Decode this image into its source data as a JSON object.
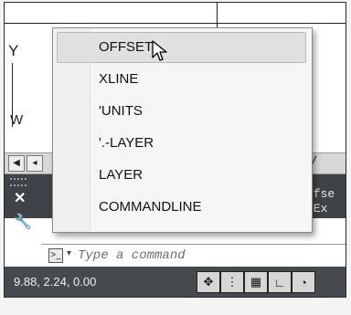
{
  "drawing": {
    "ucs_y_label": "Y",
    "ucs_w_label": "W"
  },
  "layout_tabs": {
    "nav_first_icon": "first-tab-icon",
    "nav_prev_icon": "prev-tab-icon"
  },
  "command_history": {
    "lines": [
      "ffse",
      "[Ex"
    ]
  },
  "command_line": {
    "placeholder": "Type a command",
    "prompt_icon": "command-prompt-icon"
  },
  "autocomplete_menu": {
    "items": [
      {
        "label": "OFFSET",
        "selected": true
      },
      {
        "label": "XLINE",
        "selected": false
      },
      {
        "label": "'UNITS",
        "selected": false
      },
      {
        "label": "'.-LAYER",
        "selected": false
      },
      {
        "label": "LAYER",
        "selected": false
      },
      {
        "label": "COMMANDLINE",
        "selected": false
      }
    ]
  },
  "status_bar": {
    "coordinates": "9.88, 2.24, 0.00",
    "buttons": [
      "snap-mode-icon",
      "grid-display-icon",
      "grid-icon",
      "ortho-icon",
      "polar-icon"
    ]
  },
  "colors": {
    "panel_dark": "#3f4347",
    "status_dark": "#46494d",
    "menu_bg": "#f6f6f6",
    "menu_selected": "#dfe0e2"
  }
}
